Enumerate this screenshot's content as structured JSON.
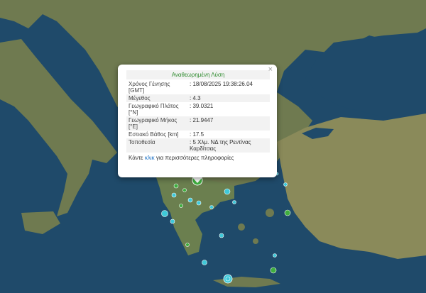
{
  "popup": {
    "title": "Αναθεωρημένη Λύση",
    "close_icon": "×",
    "rows": [
      {
        "label": "Χρόνος Γένησης [GMT]",
        "value": ": 18/08/2025 19:38:26.04"
      },
      {
        "label": "Μέγεθος",
        "value": ": 4.3"
      },
      {
        "label": "Γεωγραφικό Πλάτος [°N]",
        "value": ": 39.0321"
      },
      {
        "label": "Γεωγραφικό Μήκος [°E]",
        "value": ": 21.9447"
      },
      {
        "label": "Εστιακό Βάθος [km]",
        "value": ": 17.5"
      },
      {
        "label": "Τοποθεσία",
        "value": ": 5 Χλμ. ΝΔ της Ρεντίνας Καρδίτσας"
      }
    ],
    "footer_pre": "Κάντε ",
    "footer_link": "κλικ",
    "footer_post": " για περισσότερες πληροφορίες"
  },
  "colors": {
    "sea": "#1f4a6a",
    "land": "#6f7a50",
    "marker_cyan": "#3fc9d9",
    "marker_green": "#3fae3f",
    "highlight": "#2e8b2e"
  }
}
